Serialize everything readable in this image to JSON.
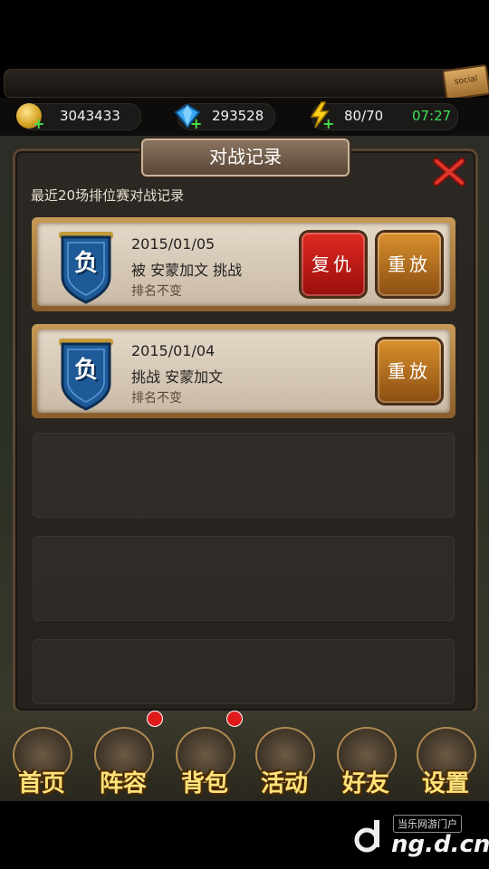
{
  "resources": {
    "gold": "3043433",
    "diamond": "293528",
    "energy": "80/70",
    "timer": "07:27"
  },
  "panel": {
    "title": "对战记录",
    "subtitle": "最近20场排位赛对战记录"
  },
  "records": [
    {
      "result": "负",
      "date": "2015/01/05",
      "description": "被 安蒙加文 挑战",
      "rank_change": "排名不变",
      "revenge_label": "复仇",
      "replay_label": "重放"
    },
    {
      "result": "负",
      "date": "2015/01/04",
      "description": "挑战 安蒙加文",
      "rank_change": "排名不变",
      "replay_label": "重放"
    }
  ],
  "bottom_nav": [
    {
      "label": "首页",
      "icon": "castle-icon"
    },
    {
      "label": "阵容",
      "icon": "soldiers-icon",
      "badge": true
    },
    {
      "label": "背包",
      "icon": "cards-icon",
      "badge": true
    },
    {
      "label": "活动",
      "icon": "scroll-map-icon"
    },
    {
      "label": "好友",
      "icon": "handshake-icon"
    },
    {
      "label": "设置",
      "icon": "gears-icon"
    }
  ],
  "watermark": {
    "tag": "当乐网游门户",
    "url": "ng.d.cn"
  },
  "colors": {
    "revenge": "#c4181a",
    "replay": "#b06a1e",
    "timer": "#3ee05a",
    "nav_label": "#ffe27a"
  }
}
